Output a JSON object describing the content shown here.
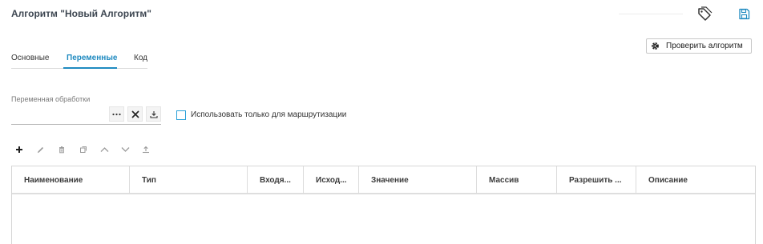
{
  "header": {
    "title": "Алгоритм \"Новый Алгоритм\""
  },
  "actions": {
    "check_label": "Проверить алгоритм"
  },
  "tabs": [
    {
      "label": "Основные"
    },
    {
      "label": "Переменные",
      "active": true
    },
    {
      "label": "Код"
    }
  ],
  "variable": {
    "label": "Переменная обработки",
    "value": ""
  },
  "routing_checkbox": {
    "label": "Использовать только для маршрутизации",
    "checked": false
  },
  "toolbar": {
    "icons": [
      "plus-icon",
      "pencil-icon",
      "trash-icon",
      "copy-icon",
      "chevron-up-icon",
      "chevron-down-icon",
      "upload-icon"
    ]
  },
  "table": {
    "columns": [
      "Наименование",
      "Тип",
      "Входя...",
      "Исход...",
      "Значение",
      "Массив",
      "Разрешить ...",
      "Описание"
    ],
    "rows": []
  },
  "colors": {
    "accent": "#1f8ac0",
    "checkbox_border": "#2aa0d8",
    "title": "#3d4651"
  }
}
